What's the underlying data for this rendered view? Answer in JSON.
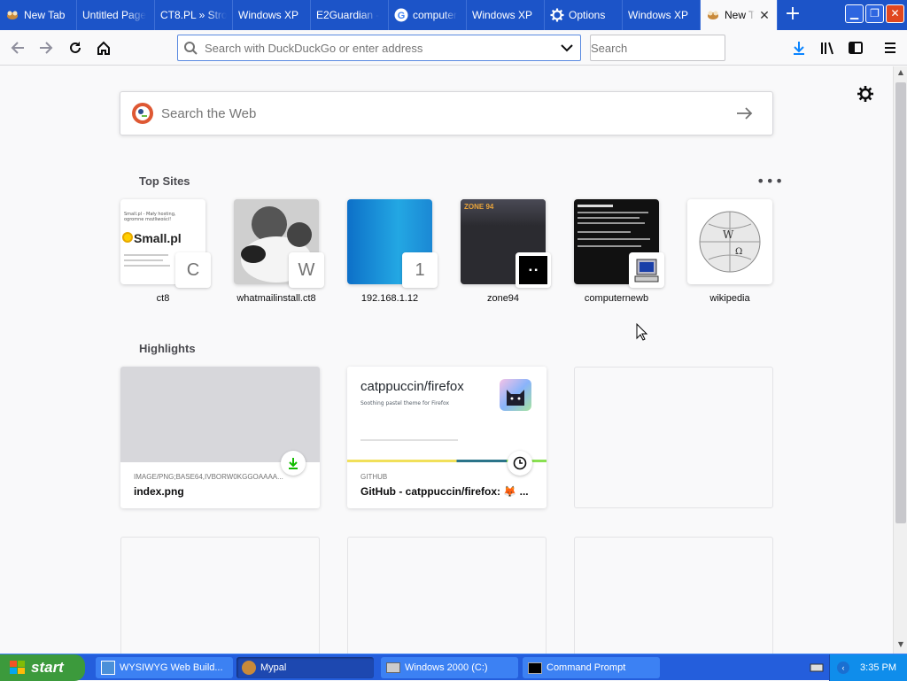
{
  "tabs": [
    {
      "label": "New Tab",
      "icon": "mypal-icon"
    },
    {
      "label": "Untitled Page",
      "icon": ""
    },
    {
      "label": "CT8.PL » Stro",
      "icon": ""
    },
    {
      "label": "Windows XP",
      "icon": ""
    },
    {
      "label": "E2Guardian - ",
      "icon": ""
    },
    {
      "label": "computer",
      "icon": "google-icon"
    },
    {
      "label": "Windows XP",
      "icon": ""
    },
    {
      "label": "Options",
      "icon": "gear-icon"
    },
    {
      "label": "Windows XP",
      "icon": ""
    },
    {
      "label": "New Tab",
      "icon": "mypal-icon"
    }
  ],
  "navbar": {
    "url_placeholder": "Search with DuckDuckGo or enter address",
    "search_placeholder": "Search"
  },
  "newtab": {
    "search_placeholder": "Search the Web",
    "top_sites_title": "Top Sites",
    "highlights_title": "Highlights",
    "top_sites": [
      {
        "label": "ct8",
        "badge": "C"
      },
      {
        "label": "whatmailinstall.ct8",
        "badge": "W"
      },
      {
        "label": "192.168.1.12",
        "badge": "1"
      },
      {
        "label": "zone94",
        "badge": ""
      },
      {
        "label": "computernewb",
        "badge": ""
      },
      {
        "label": "wikipedia",
        "badge": ""
      }
    ],
    "highlights": [
      {
        "context": "IMAGE/PNG;BASE64,IVBORW0KGGOAAAA...",
        "title": "index.png"
      },
      {
        "context": "GITHUB",
        "title": "GitHub - catppuccin/firefox: 🦊 ...",
        "preview_title": "catppuccin/firefox",
        "preview_subtitle": "Soothing pastel theme for Firefox"
      }
    ]
  },
  "thumbs": {
    "ct8_text": "Small.pl",
    "ct8_small": "Small.pl - Mały hosting, ogromne możliwości!",
    "zone94_text": "ZONE 94"
  },
  "taskbar": {
    "start_label": "start",
    "tasks": [
      {
        "label": "WYSIWYG Web Build..."
      },
      {
        "label": "Mypal"
      },
      {
        "label": "Windows 2000 (C:)"
      },
      {
        "label": "Command Prompt"
      }
    ],
    "clock": "3:35 PM"
  },
  "colors": {
    "tabbar": "#1c54c8",
    "accent": "#0a84ff",
    "taskbar": "#245edc",
    "start": "#3c9a3c"
  }
}
